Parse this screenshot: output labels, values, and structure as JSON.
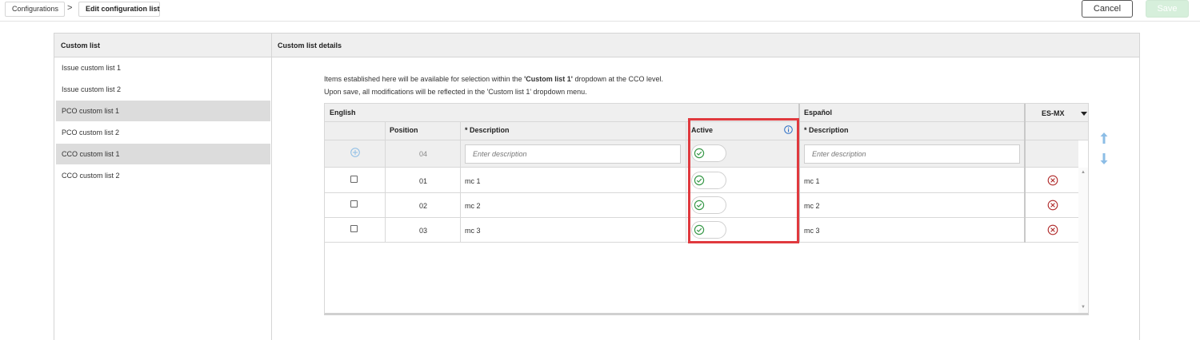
{
  "breadcrumb": {
    "root": "Configurations",
    "separator": ">",
    "current": "Edit configuration list"
  },
  "actions": {
    "cancel": "Cancel",
    "save": "Save"
  },
  "left_panel": {
    "title": "Custom list",
    "items": [
      {
        "label": "Issue custom list 1",
        "selected": false
      },
      {
        "label": "Issue custom list 2",
        "selected": false
      },
      {
        "label": "PCO custom list 1",
        "selected": true
      },
      {
        "label": "PCO custom list 2",
        "selected": false
      },
      {
        "label": "CCO custom list 1",
        "selected": true
      },
      {
        "label": "CCO custom list 2",
        "selected": false
      }
    ]
  },
  "details": {
    "title": "Custom list details",
    "info1_pre": "Items established here will be available for selection within the ",
    "info1_bold": "'Custom list 1'",
    "info1_post": " dropdown at the CCO level.",
    "info2": "Upon save, all modifications will be reflected in the 'Custom list 1' dropdown menu."
  },
  "grid": {
    "lang_english": "English",
    "lang_espanol": "Español",
    "locale": "ES-MX",
    "col_position": "Position",
    "col_description": "* Description",
    "col_active": "Active",
    "col_description_es": "* Description",
    "new_row": {
      "position": "04",
      "placeholder": "Enter description",
      "placeholder_es": "Enter description"
    },
    "rows": [
      {
        "position": "01",
        "description": "mc 1",
        "description_es": "mc 1",
        "active": true
      },
      {
        "position": "02",
        "description": "mc 2",
        "description_es": "mc 2",
        "active": true
      },
      {
        "position": "03",
        "description": "mc 3",
        "description_es": "mc 3",
        "active": true
      }
    ]
  },
  "colors": {
    "active_green": "#3a9a4a",
    "delete_red": "#b02a2a",
    "highlight_red": "#e0393e",
    "arrow_blue": "#8cbde6",
    "save_bg": "#d6efdb"
  },
  "icons": [
    "add-circle-icon",
    "check-circle-icon",
    "delete-x-icon",
    "info-icon",
    "arrow-up-icon",
    "arrow-down-icon",
    "dropdown-caret-icon"
  ]
}
